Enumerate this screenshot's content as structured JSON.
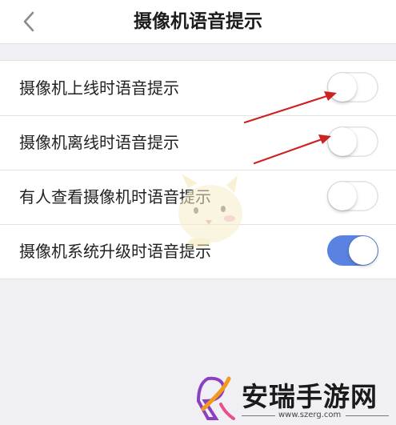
{
  "header": {
    "title": "摄像机语音提示",
    "back_icon": "chevron-left-icon"
  },
  "settings": [
    {
      "label": "摄像机上线时语音提示",
      "enabled": false
    },
    {
      "label": "摄像机离线时语音提示",
      "enabled": false
    },
    {
      "label": "有人查看摄像机时语音提示",
      "enabled": false
    },
    {
      "label": "摄像机系统升级时语音提示",
      "enabled": true
    }
  ],
  "colors": {
    "toggle_on": "#5a82e0",
    "annotation_arrow": "#cc2222",
    "background": "#efeff4"
  },
  "watermark": {
    "name": "安瑞手游网",
    "url": "www.szerg.com"
  }
}
